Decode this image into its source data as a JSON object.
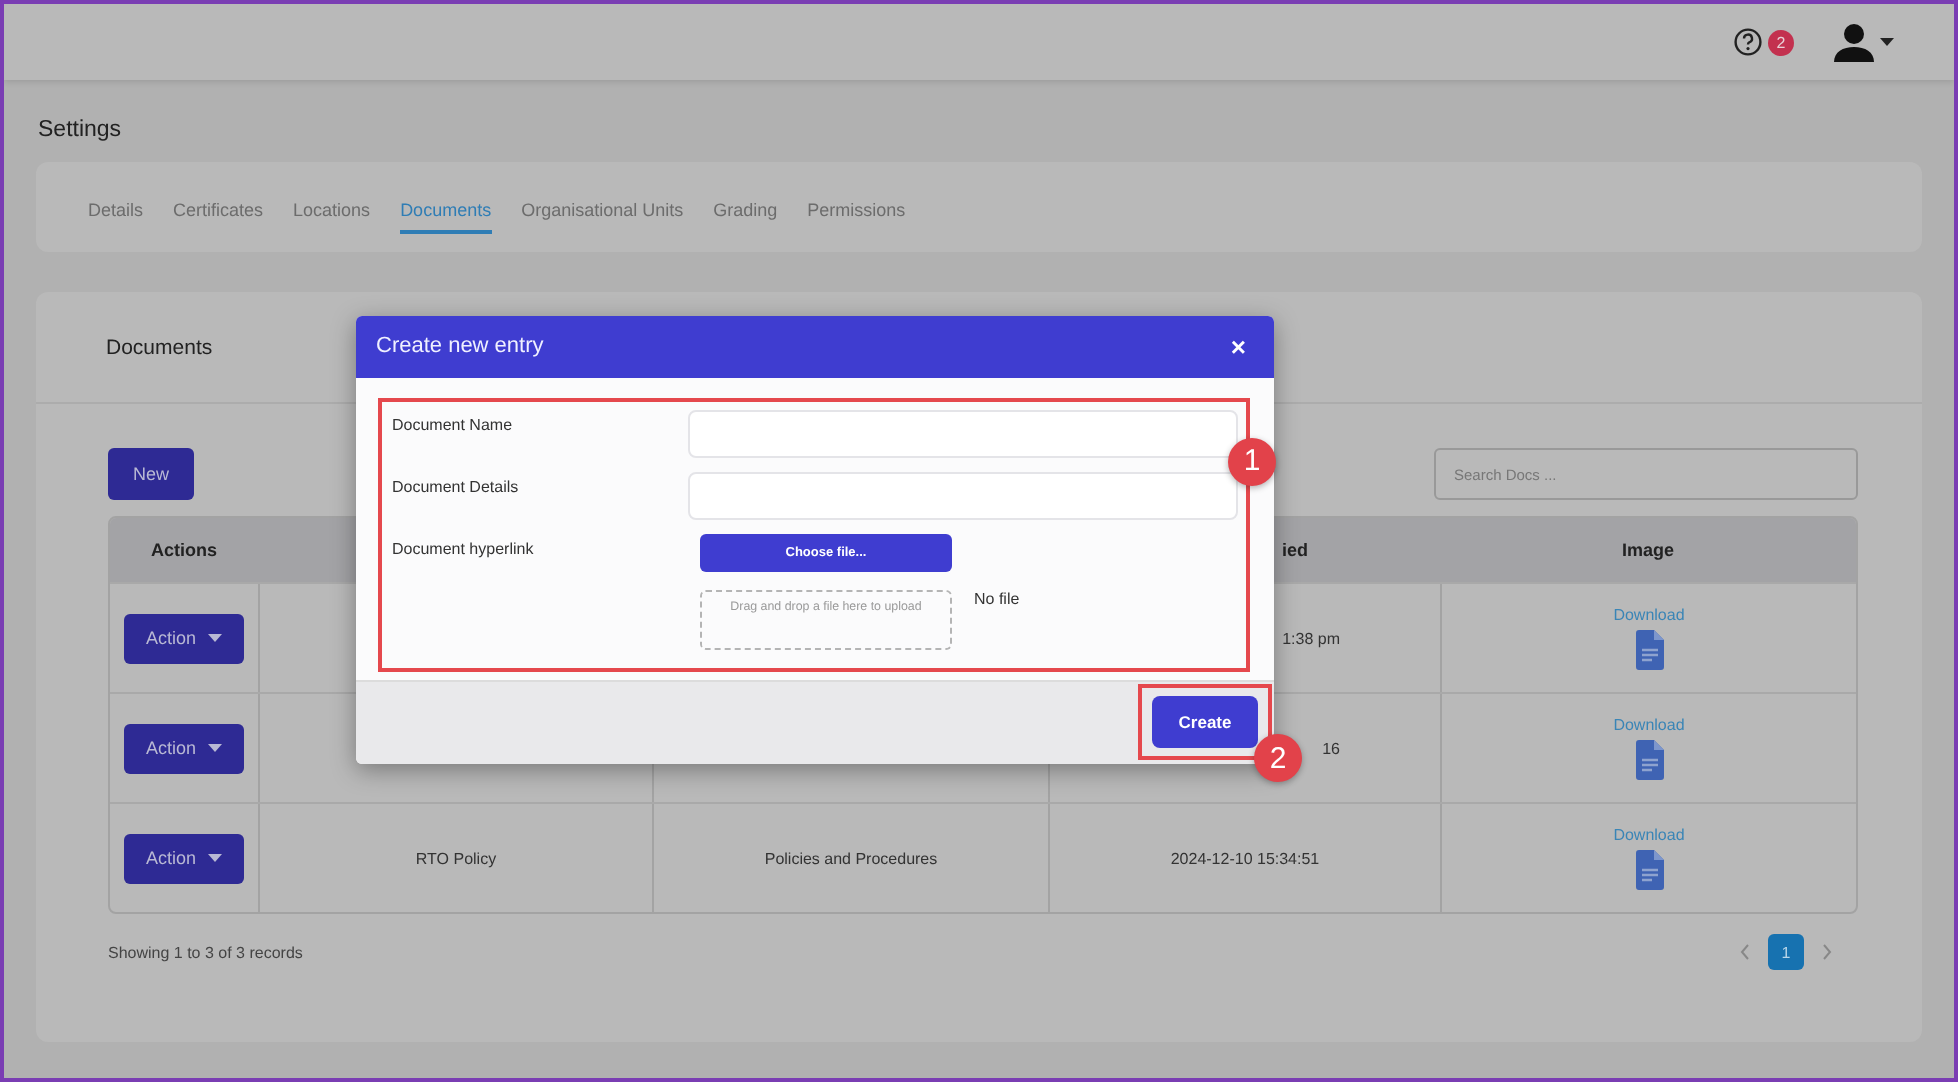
{
  "topbar": {
    "help_badge": "2"
  },
  "page_title": "Settings",
  "tabs": [
    {
      "label": "Details",
      "selected": false
    },
    {
      "label": "Certificates",
      "selected": false
    },
    {
      "label": "Locations",
      "selected": false
    },
    {
      "label": "Documents",
      "selected": true
    },
    {
      "label": "Organisational Units",
      "selected": false
    },
    {
      "label": "Grading",
      "selected": false
    },
    {
      "label": "Permissions",
      "selected": false
    }
  ],
  "documents": {
    "title": "Documents",
    "new_button": "New",
    "search": {
      "placeholder": "Search Docs ..."
    },
    "table": {
      "headers": {
        "actions": "Actions",
        "modified": "ied",
        "image": "Image"
      },
      "rows": [
        {
          "covered": true,
          "action": "Action",
          "modified": "1:38 pm",
          "link": "Download"
        },
        {
          "covered": true,
          "action": "Action",
          "modified": "16",
          "link": "Download"
        },
        {
          "covered": false,
          "action": "Action",
          "name": "RTO Policy",
          "category": "Policies and Procedures",
          "modified": "2024-12-10 15:34:51",
          "link": "Download"
        }
      ]
    },
    "footer": "Showing 1 to 3 of 3 records",
    "pages": [
      {
        "label": "1",
        "selected": true
      }
    ]
  },
  "modal": {
    "title": "Create new entry",
    "close": "×",
    "fields": [
      {
        "kind": "text",
        "label": "Document Name"
      },
      {
        "kind": "text",
        "label": "Document Details"
      },
      {
        "kind": "file",
        "label": "Document hyperlink",
        "button": "Choose file...",
        "drop_hint": "Drag and drop a file here to upload",
        "status": "No file"
      }
    ],
    "submit": "Create"
  },
  "annotations": [
    "1",
    "2"
  ]
}
